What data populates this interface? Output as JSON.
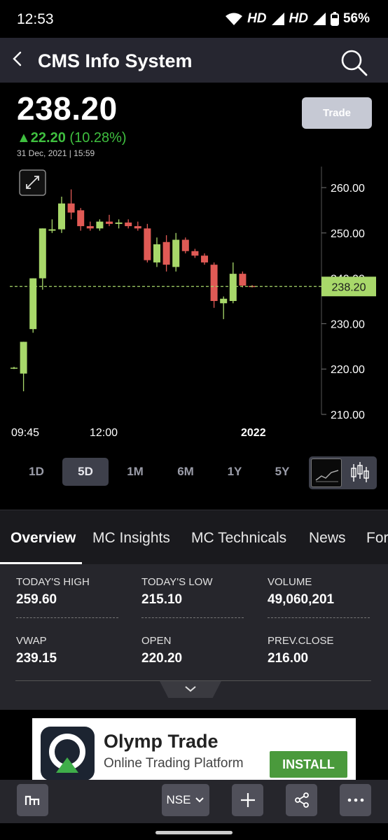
{
  "status_bar": {
    "time": "12:53",
    "net1": "HD",
    "net2": "HD",
    "battery": "56%"
  },
  "header": {
    "title": "CMS Info System"
  },
  "quote": {
    "price": "238.20",
    "change": "▲22.20",
    "change_pct": "(10.28%)",
    "timestamp": "31 Dec, 2021 | 15:59",
    "trade_label": "Trade"
  },
  "chart_data": {
    "type": "candlestick",
    "y_ticks": [
      "260.00",
      "250.00",
      "240.00",
      "230.00",
      "220.00",
      "210.00"
    ],
    "y_range": [
      210,
      265
    ],
    "x_labels": [
      "09:45",
      "12:00",
      "2022"
    ],
    "last_price_label": "238.20",
    "last_price": 238.2,
    "candles": [
      {
        "o": 220.2,
        "h": 220.5,
        "l": 220.0,
        "c": 220.3
      },
      {
        "o": 219.0,
        "h": 225.0,
        "l": 215.1,
        "c": 226.0
      },
      {
        "o": 228.8,
        "h": 238.5,
        "l": 228.0,
        "c": 240.0
      },
      {
        "o": 240.0,
        "h": 247.5,
        "l": 237.5,
        "c": 251.0
      },
      {
        "o": 250.5,
        "h": 253.0,
        "l": 250.0,
        "c": 250.8
      },
      {
        "o": 250.8,
        "h": 258.0,
        "l": 250.0,
        "c": 256.5
      },
      {
        "o": 256.5,
        "h": 259.6,
        "l": 253.0,
        "c": 254.5
      },
      {
        "o": 255.0,
        "h": 255.5,
        "l": 250.5,
        "c": 251.5
      },
      {
        "o": 251.5,
        "h": 252.5,
        "l": 250.5,
        "c": 251.0
      },
      {
        "o": 251.0,
        "h": 253.0,
        "l": 250.5,
        "c": 252.5
      },
      {
        "o": 252.5,
        "h": 254.0,
        "l": 251.5,
        "c": 252.0
      },
      {
        "o": 252.0,
        "h": 253.0,
        "l": 251.0,
        "c": 252.3
      },
      {
        "o": 252.3,
        "h": 253.0,
        "l": 251.0,
        "c": 251.5
      },
      {
        "o": 251.5,
        "h": 252.5,
        "l": 250.5,
        "c": 251.0
      },
      {
        "o": 251.0,
        "h": 252.0,
        "l": 243.5,
        "c": 244.0
      },
      {
        "o": 243.5,
        "h": 249.0,
        "l": 242.5,
        "c": 247.5
      },
      {
        "o": 248.0,
        "h": 249.5,
        "l": 241.5,
        "c": 243.0
      },
      {
        "o": 242.5,
        "h": 250.0,
        "l": 241.5,
        "c": 248.5
      },
      {
        "o": 248.5,
        "h": 249.0,
        "l": 245.5,
        "c": 246.0
      },
      {
        "o": 246.0,
        "h": 246.5,
        "l": 244.5,
        "c": 245.0
      },
      {
        "o": 245.0,
        "h": 245.5,
        "l": 243.0,
        "c": 243.5
      },
      {
        "o": 243.0,
        "h": 243.5,
        "l": 233.5,
        "c": 235.0
      },
      {
        "o": 234.5,
        "h": 236.0,
        "l": 231.0,
        "c": 235.5
      },
      {
        "o": 235.0,
        "h": 243.5,
        "l": 234.5,
        "c": 241.0
      },
      {
        "o": 241.0,
        "h": 241.5,
        "l": 238.0,
        "c": 238.4
      },
      {
        "o": 238.3,
        "h": 238.5,
        "l": 238.0,
        "c": 238.2
      }
    ]
  },
  "range_tabs": [
    "1D",
    "5D",
    "1M",
    "6M",
    "1Y",
    "5Y"
  ],
  "active_range": "5D",
  "tabs": [
    "Overview",
    "MC Insights",
    "MC Technicals",
    "News",
    "For"
  ],
  "stats": [
    {
      "label": "TODAY'S HIGH",
      "value": "259.60"
    },
    {
      "label": "TODAY'S LOW",
      "value": "215.10"
    },
    {
      "label": "VOLUME",
      "value": "49,060,201"
    },
    {
      "label": "VWAP",
      "value": "239.15"
    },
    {
      "label": "OPEN",
      "value": "220.20"
    },
    {
      "label": "PREV.CLOSE",
      "value": "216.00"
    }
  ],
  "ad": {
    "brand": "Olymp Trade",
    "sub": "Online Trading Platform",
    "install": "INSTALL"
  },
  "bottom_bar": {
    "exchange": "NSE"
  },
  "colors": {
    "up": "#a8d86a",
    "down": "#e05a55",
    "accent_green": "#3fbf3f",
    "price_tag": "#a8d86a"
  }
}
